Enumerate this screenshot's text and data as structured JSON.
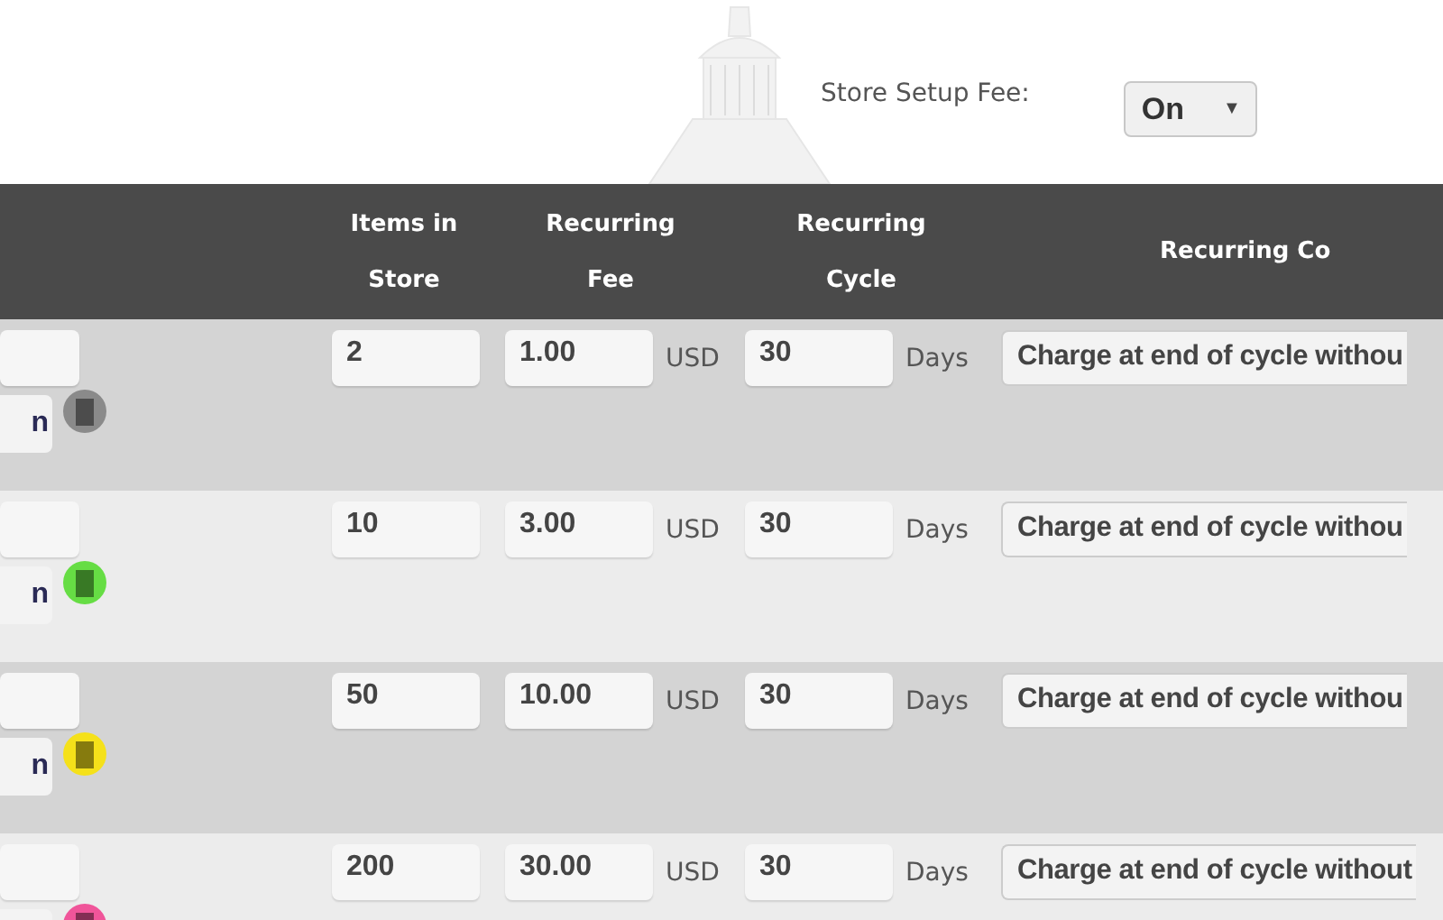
{
  "setup_fee": {
    "label": "Store Setup Fee:",
    "value": "On",
    "caret": "▼"
  },
  "table": {
    "columns": [
      {
        "label": "Items in Store"
      },
      {
        "label": "Recurring Fee"
      },
      {
        "label": "Recurring Cycle"
      },
      {
        "label": "Recurring Co"
      }
    ],
    "rows": [
      {
        "button": "n",
        "color": "#8a8a8a",
        "items": "2",
        "fee": "1.00",
        "currency": "USD",
        "cycle": "30",
        "unit": "Days",
        "condition": "Charge at end of cycle withou"
      },
      {
        "button": "n",
        "color": "#66dd44",
        "items": "10",
        "fee": "3.00",
        "currency": "USD",
        "cycle": "30",
        "unit": "Days",
        "condition": "Charge at end of cycle withou"
      },
      {
        "button": "n",
        "color": "#f5e11a",
        "items": "50",
        "fee": "10.00",
        "currency": "USD",
        "cycle": "30",
        "unit": "Days",
        "condition": "Charge at end of cycle withou"
      },
      {
        "color": "#f0559a",
        "items": "200",
        "fee": "30.00",
        "currency": "USD",
        "cycle": "30",
        "unit": "Days",
        "condition": "Charge at end of cycle without"
      }
    ]
  }
}
